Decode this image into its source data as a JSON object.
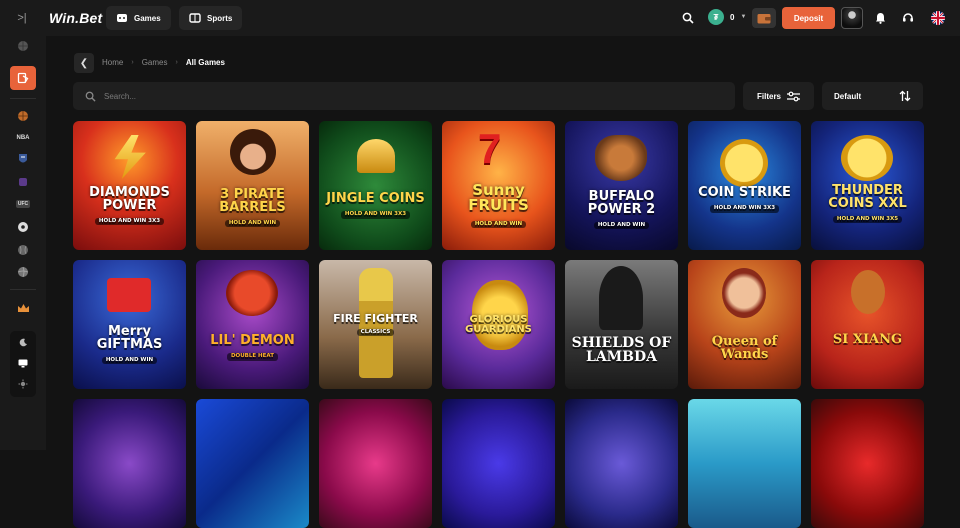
{
  "header": {
    "logo": "Win.Bet",
    "nav": [
      {
        "label": "Games",
        "icon": "games-icon"
      },
      {
        "label": "Sports",
        "icon": "sports-icon"
      }
    ],
    "balance": "0",
    "currency_icon": "tether-coin-icon",
    "deposit_label": "Deposit",
    "accent": "#e8633a"
  },
  "sidebar": {
    "icons": [
      "basketball-icon",
      "casino-icon",
      "basketball-icon",
      "nba-icon",
      "nfl-icon",
      "esports-icon",
      "ufc-icon",
      "soccer-icon",
      "baseball-icon",
      "volleyball-icon",
      "vip-crown-icon",
      "moon-icon",
      "monitor-icon",
      "sun-icon"
    ]
  },
  "breadcrumb": {
    "items": [
      "Home",
      "Games",
      "All Games"
    ]
  },
  "search": {
    "placeholder": "Search..."
  },
  "filters": {
    "label": "Filters"
  },
  "sort": {
    "label": "Default"
  },
  "games": [
    {
      "title": "DIAMONDS POWER",
      "subtitle": "HOLD AND WIN 3X3"
    },
    {
      "title": "3 PIRATE BARRELS",
      "subtitle": "HOLD AND WIN"
    },
    {
      "title": "JINGLE COINS",
      "subtitle": "HOLD AND WIN 3X3"
    },
    {
      "title": "Sunny FRUITS",
      "subtitle": "HOLD AND WIN"
    },
    {
      "title": "BUFFALO POWER 2",
      "subtitle": "HOLD AND WIN"
    },
    {
      "title": "COIN STRIKE",
      "subtitle": "HOLD AND WIN 3X3"
    },
    {
      "title": "THUNDER COINS XXL",
      "subtitle": "HOLD AND WIN 3X5"
    },
    {
      "title": "Merry GIFTMAS",
      "subtitle": "HOLD AND WIN"
    },
    {
      "title": "LIL' DEMON",
      "subtitle": "DOUBLE HEAT"
    },
    {
      "title": "FIRE FIGHTER",
      "subtitle": "CLASSICS"
    },
    {
      "title": "GLORIOUS GUARDIANS",
      "subtitle": ""
    },
    {
      "title": "SHIELDS OF LAMBDA",
      "subtitle": ""
    },
    {
      "title": "Queen of Wands",
      "subtitle": ""
    },
    {
      "title": "SI XIANG",
      "subtitle": ""
    },
    {
      "title": "",
      "subtitle": ""
    },
    {
      "title": "",
      "subtitle": ""
    },
    {
      "title": "",
      "subtitle": ""
    },
    {
      "title": "",
      "subtitle": ""
    },
    {
      "title": "",
      "subtitle": ""
    },
    {
      "title": "",
      "subtitle": ""
    },
    {
      "title": "",
      "subtitle": ""
    }
  ]
}
